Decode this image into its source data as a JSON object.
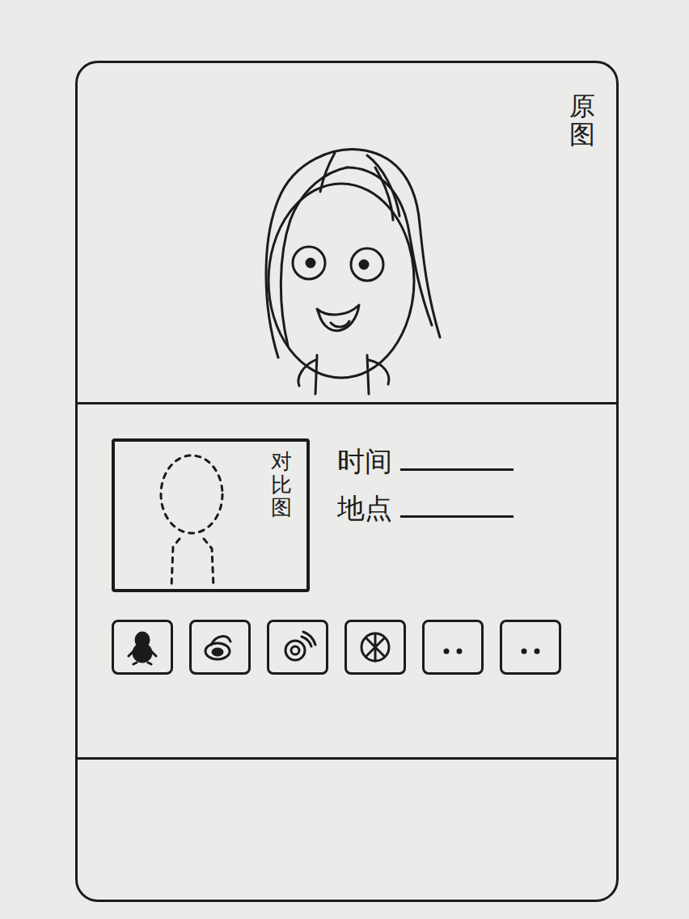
{
  "original": {
    "label": "原图"
  },
  "compare": {
    "label": "对比图"
  },
  "fields": [
    {
      "label": "时间"
    },
    {
      "label": "地点"
    }
  ],
  "share_buttons": [
    {
      "kind": "penguin"
    },
    {
      "kind": "weibo"
    },
    {
      "kind": "moments"
    },
    {
      "kind": "friends"
    },
    {
      "kind": "blank"
    },
    {
      "kind": "blank"
    }
  ]
}
